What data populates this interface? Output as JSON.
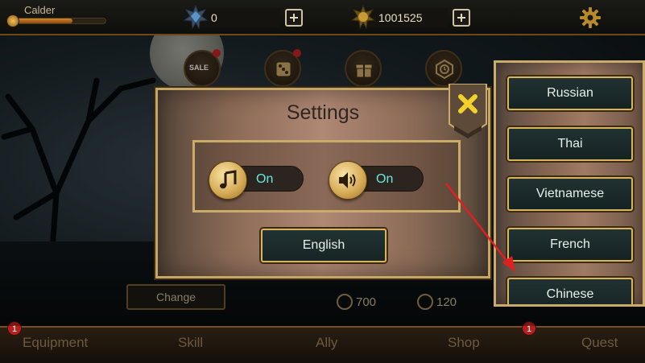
{
  "player": {
    "name": "Calder",
    "xp_fraction": 0.65
  },
  "currencies": [
    {
      "name": "gems",
      "icon": "gem-icon",
      "value": "0"
    },
    {
      "name": "coins",
      "icon": "coin-icon",
      "value": "1001525"
    }
  ],
  "quick_actions": [
    {
      "name": "sale",
      "label": "SALE",
      "icon": "sale-icon",
      "has_notification": true
    },
    {
      "name": "dice",
      "icon": "dice-icon",
      "has_notification": true
    },
    {
      "name": "gift",
      "icon": "gift-icon",
      "has_notification": false
    },
    {
      "name": "clock",
      "icon": "clock-icon",
      "has_notification": false
    }
  ],
  "settings": {
    "title": "Settings",
    "music": {
      "icon": "music-note-icon",
      "state": "On"
    },
    "sound": {
      "icon": "speaker-icon",
      "state": "On"
    },
    "language_button": "English"
  },
  "language_list": [
    "Russian",
    "Thai",
    "Vietnamese",
    "French",
    "Chinese"
  ],
  "lower_menu": {
    "change_label": "Change",
    "stats": [
      {
        "icon": "heart-icon",
        "value": "700"
      },
      {
        "icon": "arrow-up-icon",
        "value": "120"
      }
    ],
    "nav": [
      {
        "label": "Equipment",
        "badge": "1"
      },
      {
        "label": "Skill",
        "badge": ""
      },
      {
        "label": "Ally",
        "badge": ""
      },
      {
        "label": "Shop",
        "badge": ""
      },
      {
        "label": "Quest",
        "badge": "1"
      }
    ]
  },
  "colors": {
    "accent_gold": "#c9ab6a",
    "toggle_text": "#68e6e0",
    "annotation_arrow": "#e02020"
  }
}
